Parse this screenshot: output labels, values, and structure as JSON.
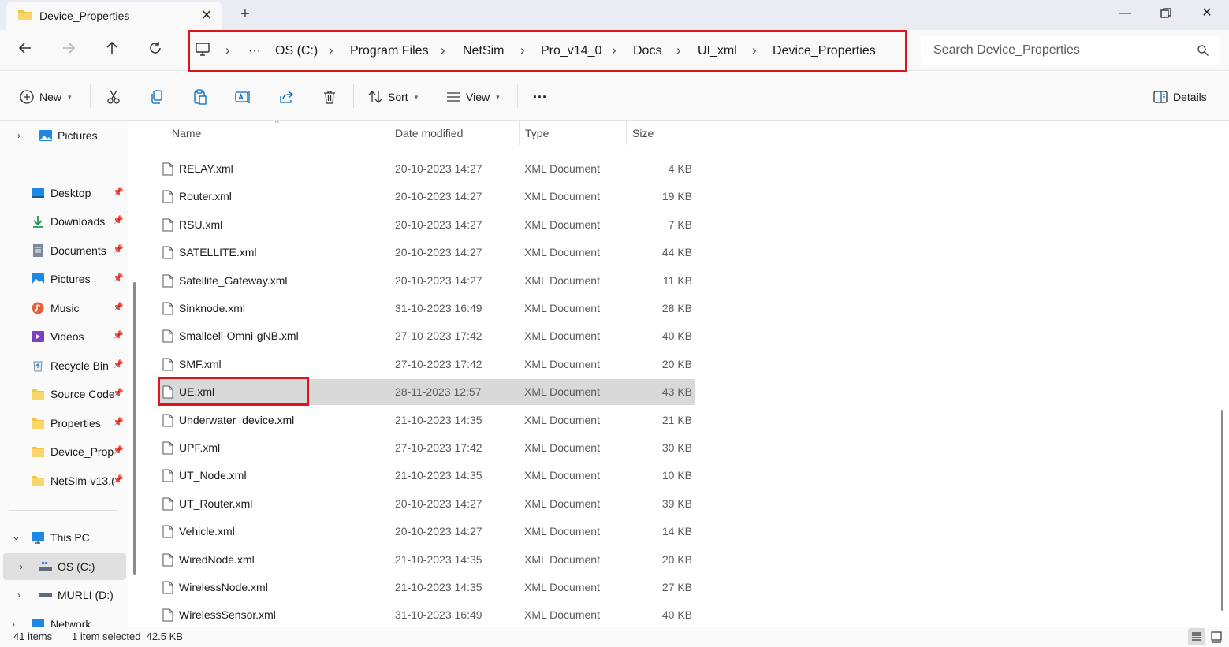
{
  "tab": {
    "title": "Device_Properties"
  },
  "address": {
    "crumbs": [
      "OS (C:)",
      "Program Files",
      "NetSim",
      "Pro_v14_0",
      "Docs",
      "UI_xml",
      "Device_Properties"
    ],
    "ellipsis": "···",
    "search_placeholder": "Search Device_Properties"
  },
  "toolbar": {
    "new_label": "New",
    "sort_label": "Sort",
    "view_label": "View",
    "more_label": "···",
    "details_label": "Details"
  },
  "sidebar": {
    "items": [
      {
        "label": "Pictures",
        "icon": "pictures-icon"
      },
      {
        "label": "Desktop",
        "icon": "desktop-icon"
      },
      {
        "label": "Downloads",
        "icon": "downloads-icon"
      },
      {
        "label": "Documents",
        "icon": "documents-icon"
      },
      {
        "label": "Pictures",
        "icon": "pictures-icon"
      },
      {
        "label": "Music",
        "icon": "music-icon"
      },
      {
        "label": "Videos",
        "icon": "videos-icon"
      },
      {
        "label": "Recycle Bin",
        "icon": "recycle-bin-icon"
      },
      {
        "label": "Source Code",
        "icon": "folder-icon"
      },
      {
        "label": "Properties",
        "icon": "folder-icon"
      },
      {
        "label": "Device_Prope",
        "icon": "folder-icon"
      },
      {
        "label": "NetSim-v13.(",
        "icon": "folder-icon"
      },
      {
        "label": "This PC",
        "icon": "this-pc-icon"
      },
      {
        "label": "OS (C:)",
        "icon": "drive-icon"
      },
      {
        "label": "MURLI (D:)",
        "icon": "drive-icon"
      },
      {
        "label": "Network",
        "icon": "network-icon"
      }
    ]
  },
  "columns": {
    "name": "Name",
    "date": "Date modified",
    "type": "Type",
    "size": "Size"
  },
  "files": [
    {
      "name": "RELAY.xml",
      "date": "20-10-2023 14:27",
      "type": "XML Document",
      "size": "4 KB"
    },
    {
      "name": "Router.xml",
      "date": "20-10-2023 14:27",
      "type": "XML Document",
      "size": "19 KB"
    },
    {
      "name": "RSU.xml",
      "date": "20-10-2023 14:27",
      "type": "XML Document",
      "size": "7 KB"
    },
    {
      "name": "SATELLITE.xml",
      "date": "20-10-2023 14:27",
      "type": "XML Document",
      "size": "44 KB"
    },
    {
      "name": "Satellite_Gateway.xml",
      "date": "20-10-2023 14:27",
      "type": "XML Document",
      "size": "11 KB"
    },
    {
      "name": "Sinknode.xml",
      "date": "31-10-2023 16:49",
      "type": "XML Document",
      "size": "28 KB"
    },
    {
      "name": "Smallcell-Omni-gNB.xml",
      "date": "27-10-2023 17:42",
      "type": "XML Document",
      "size": "40 KB"
    },
    {
      "name": "SMF.xml",
      "date": "27-10-2023 17:42",
      "type": "XML Document",
      "size": "20 KB"
    },
    {
      "name": "UE.xml",
      "date": "28-11-2023 12:57",
      "type": "XML Document",
      "size": "43 KB",
      "selected": true
    },
    {
      "name": "Underwater_device.xml",
      "date": "21-10-2023 14:35",
      "type": "XML Document",
      "size": "21 KB"
    },
    {
      "name": "UPF.xml",
      "date": "27-10-2023 17:42",
      "type": "XML Document",
      "size": "30 KB"
    },
    {
      "name": "UT_Node.xml",
      "date": "21-10-2023 14:35",
      "type": "XML Document",
      "size": "10 KB"
    },
    {
      "name": "UT_Router.xml",
      "date": "20-10-2023 14:27",
      "type": "XML Document",
      "size": "39 KB"
    },
    {
      "name": "Vehicle.xml",
      "date": "20-10-2023 14:27",
      "type": "XML Document",
      "size": "14 KB"
    },
    {
      "name": "WiredNode.xml",
      "date": "21-10-2023 14:35",
      "type": "XML Document",
      "size": "20 KB"
    },
    {
      "name": "WirelessNode.xml",
      "date": "21-10-2023 14:35",
      "type": "XML Document",
      "size": "27 KB"
    },
    {
      "name": "WirelessSensor.xml",
      "date": "31-10-2023 16:49",
      "type": "XML Document",
      "size": "40 KB"
    }
  ],
  "status": {
    "items": "41 items",
    "selection": "1 item selected  42.5 KB"
  },
  "colors": {
    "highlight": "#e0141e",
    "selected_row": "#d9d9d9",
    "folder": "#f4c542",
    "accent": "#0067c0"
  }
}
